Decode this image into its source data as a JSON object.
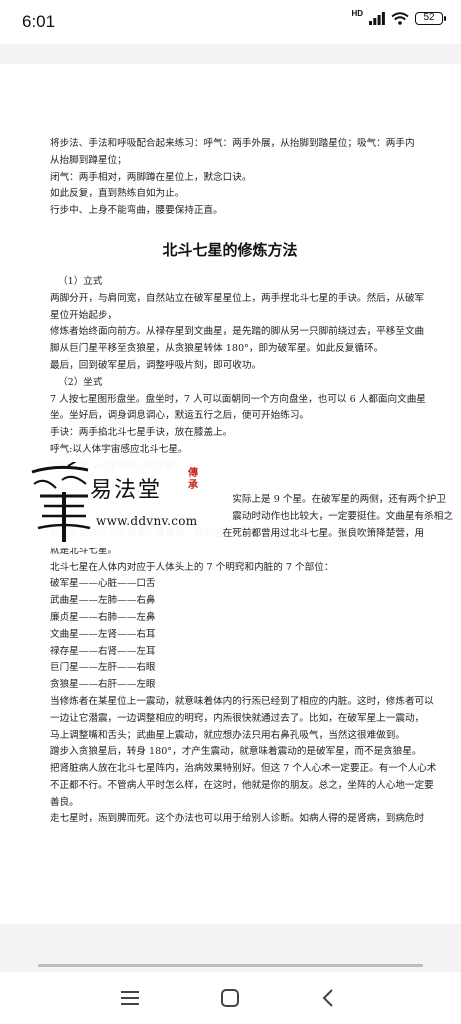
{
  "status_bar": {
    "time": "6:01",
    "network_label": "HD",
    "battery": "52"
  },
  "document": {
    "intro_lines": [
      "将步法、手法和呼吸配合起来练习：呼气：两手外展，从抬脚到踏星位；吸气：两手内",
      "从抬脚到蹲星位；",
      "闭气：两手相对，两脚蹲在星位上，默念口诀。",
      "如此反复，直到熟练自如为止。",
      "行步中、上身不能弯曲，腰要保持正直。"
    ],
    "heading": "北斗七星的修炼方法",
    "body_lines": [
      "（1）立式",
      "两脚分开，与肩同宽，自然站立在破军星星位上，两手捏北斗七星的手诀。然后，从破军",
      "星位开始起步，",
      "修炼者始终面向前方。从禄存星到文曲星，是先踏的脚从另一只脚前绕过去，平移至文曲",
      "脚从巨门星平移至贪狼星，从贪狼星转体 180°，即为破军星。如此反复循环。",
      "最后，回到破军星后，调整呼吸片刻，即可收功。",
      "（2）坐式",
      "7 人按七星图形盘坐。盘坐时，7 人可以面朝同一个方向盘坐，也可以 6 人都面向文曲星",
      "坐。坐好后，调身调息调心，默运五行之后，便可开始练习。",
      "手诀：两手掐北斗七星手诀，放在膝盖上。",
      "呼气:以人体宇宙感应北斗七星。",
      "吸气：北斗七星回应人体宇宙。",
      "",
      "　　　　　　　　　　　　　　　　　　　实际上是 9 个星。在破军星的两侧，还有两个护卫",
      "　　　　　　　　　　　　　　　　　　　震动时动作也比较大，一定要挺住。文曲星有杀相之",
      "战吉时文称之为杀相星。诸葛亮，刘伯温在死前都曾用过北斗七星。张良吹箫降楚营，用",
      "就是北斗七星。",
      "北斗七星在人体内对应于人体头上的 7 个明窍和内脏的 7 个部位：",
      "破军星——心脏——口舌",
      "武曲星——左肺——右鼻",
      "廉贞星——右肺——左鼻",
      "文曲星——左肾——右耳",
      "禄存星——右肾——左耳",
      "巨门星——左肝——右眼",
      "贪狼星——右肝——左眼",
      "当修炼者在某星位上一震动，就意味着体内的行炁已经到了相应的内脏。这时，修炼者可以",
      "一边让它潜震，一边调整相应的明窍，内炁很快就通过去了。比如，在破军星上一震动，",
      "马上调整嘴和舌头；武曲星上震动，就应想办法只用右鼻孔吸气，当然这很难做到。",
      "蹭步入贪狼星后，转身 180°，才产生震动，就意味着震动的是破军星，而不是贪狼星。",
      "把肾脏病人放在北斗七星阵内，治病效果特别好。但这 7 个人心术一定要正。有一个人心术",
      "不正都不行。不管病人平时怎么样，在这时，他就是你的朋友。总之，坐阵的人心地一定要",
      "善良。",
      "走七星时，炁到脾而死。这个办法也可以用于给别人诊断。如病人得的是肾病，到病危时"
    ]
  },
  "watermark": {
    "logo_char": "壐",
    "title": "易法堂",
    "seal": "傳承",
    "url": "www.ddvnv.com"
  },
  "nav_bar": {
    "menu_icon": "menu-icon",
    "home_icon": "home-icon",
    "back_icon": "back-icon"
  }
}
